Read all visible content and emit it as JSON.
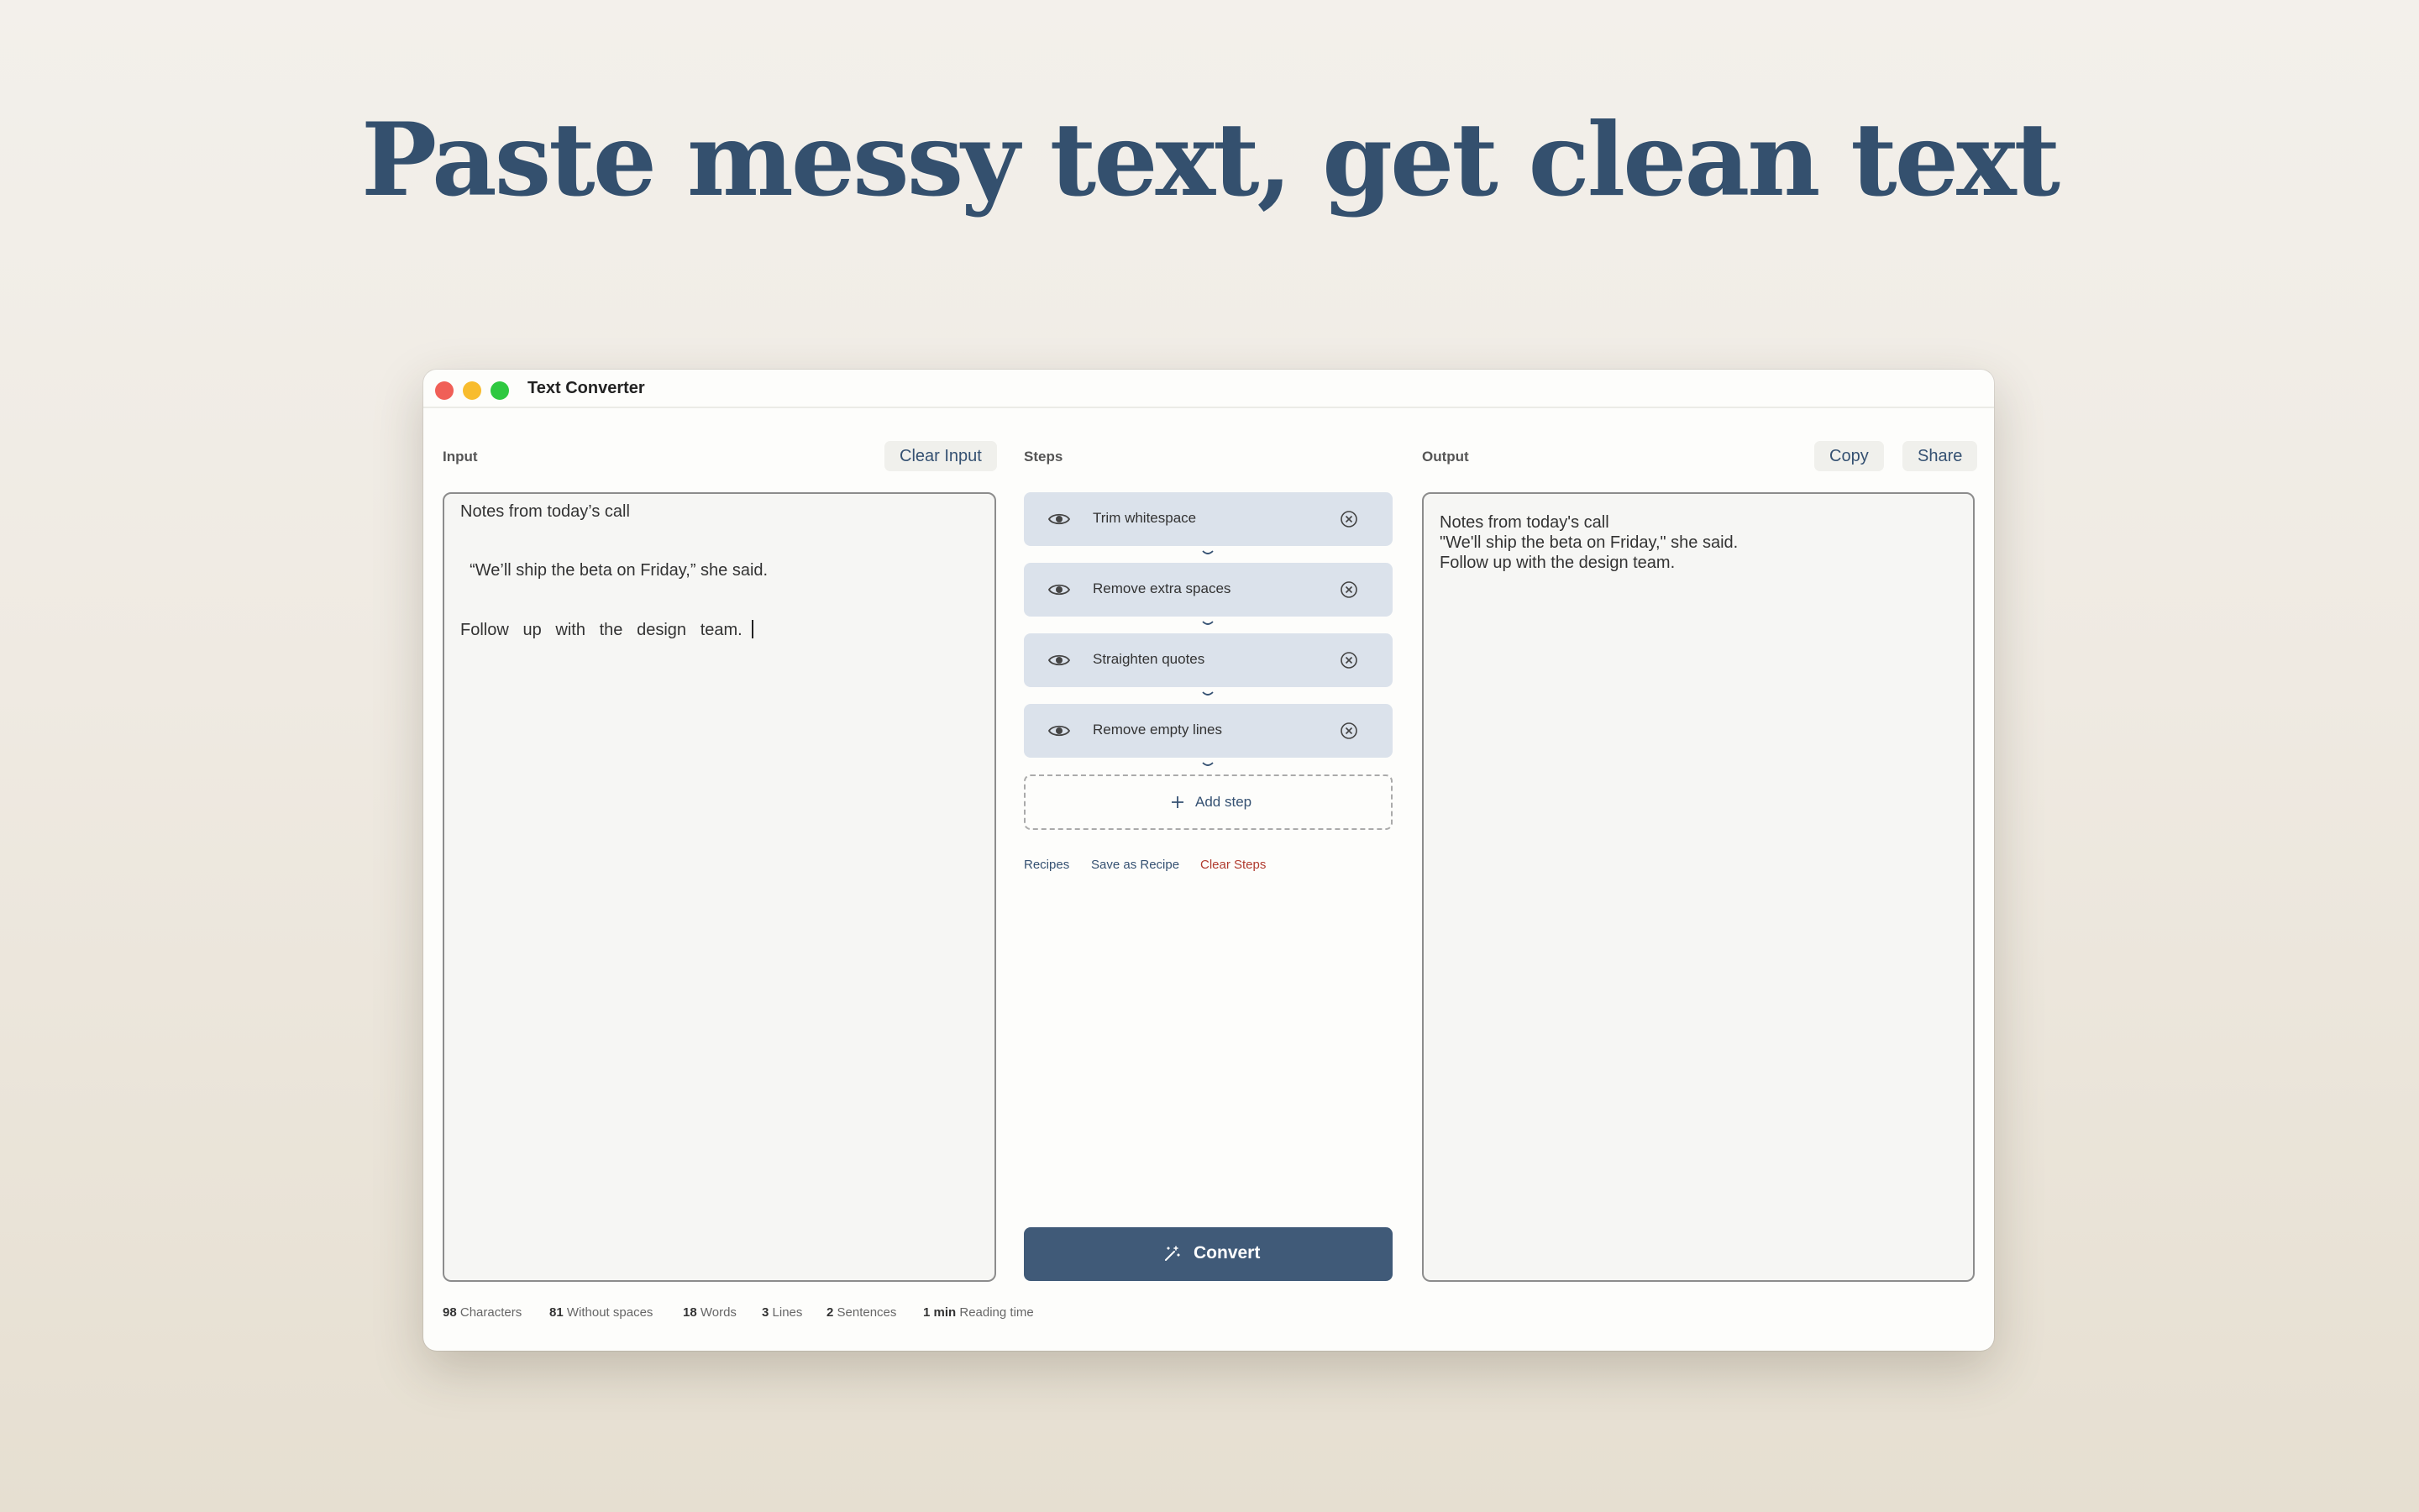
{
  "headline": "Paste messy text, get clean text",
  "window": {
    "title": "Text Converter"
  },
  "input": {
    "label": "Input",
    "clear_label": "Clear Input",
    "lines": [
      "Notes from today’s call",
      "  “We’ll ship the beta on Friday,” she said.",
      "Follow   up   with   the   design   team.  "
    ]
  },
  "steps": {
    "label": "Steps",
    "items": [
      {
        "label": "Trim whitespace",
        "icon": "eye-icon",
        "remove_icon": "remove-circle-icon"
      },
      {
        "label": "Remove extra spaces",
        "icon": "eye-icon",
        "remove_icon": "remove-circle-icon"
      },
      {
        "label": "Straighten quotes",
        "icon": "eye-icon",
        "remove_icon": "remove-circle-icon"
      },
      {
        "label": "Remove empty lines",
        "icon": "eye-icon",
        "remove_icon": "remove-circle-icon"
      }
    ],
    "add_label": "Add step",
    "links": {
      "recipes": "Recipes",
      "save_recipe": "Save as Recipe",
      "clear_steps": "Clear Steps"
    },
    "convert_label": "Convert"
  },
  "output": {
    "label": "Output",
    "copy_label": "Copy",
    "share_label": "Share",
    "lines": [
      "Notes from today's call",
      "\"We'll ship the beta on Friday,\" she said.",
      "Follow up with the design team."
    ]
  },
  "stats": [
    {
      "value": "98",
      "label": "Characters"
    },
    {
      "value": "81",
      "label": "Without spaces"
    },
    {
      "value": "18",
      "label": "Words"
    },
    {
      "value": "3",
      "label": "Lines"
    },
    {
      "value": "2",
      "label": "Sentences"
    },
    {
      "value": "1 min",
      "label": "Reading time"
    }
  ],
  "colors": {
    "accent": "#405a78",
    "link": "#355172",
    "danger": "#b03a2e",
    "step_bg": "#dbe2eb",
    "headline": "#34506e"
  }
}
